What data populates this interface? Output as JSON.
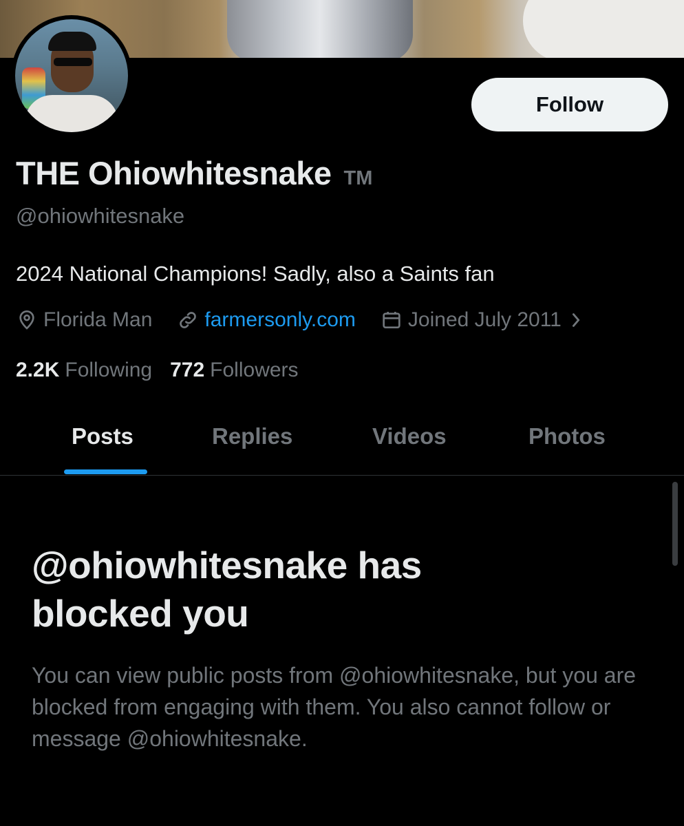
{
  "profile": {
    "display_name": "THE Ohiowhitesnake",
    "badge": "TM",
    "handle": "@ohiowhitesnake",
    "bio": "2024 National Champions! Sadly, also a Saints fan",
    "location": "Florida Man",
    "website": "farmersonly.com",
    "joined": "Joined July 2011"
  },
  "actions": {
    "follow_label": "Follow"
  },
  "stats": {
    "following_count": "2.2K",
    "following_label": "Following",
    "followers_count": "772",
    "followers_label": "Followers"
  },
  "tabs": [
    {
      "label": "Posts",
      "active": true
    },
    {
      "label": "Replies"
    },
    {
      "label": "Videos"
    },
    {
      "label": "Photos"
    }
  ],
  "blocked": {
    "title": "@ohiowhitesnake has blocked you",
    "message": "You can view public posts from @ohiowhitesnake, but you are blocked from engaging with them. You also cannot follow or message @ohiowhitesnake."
  },
  "icons": {
    "location": "location-pin-icon",
    "website": "link-icon",
    "joined": "calendar-icon",
    "joined_more": "chevron-right-icon"
  },
  "colors": {
    "accent": "#1d9bf0",
    "background": "#000000",
    "muted": "#71767b",
    "text": "#e7e9ea"
  }
}
